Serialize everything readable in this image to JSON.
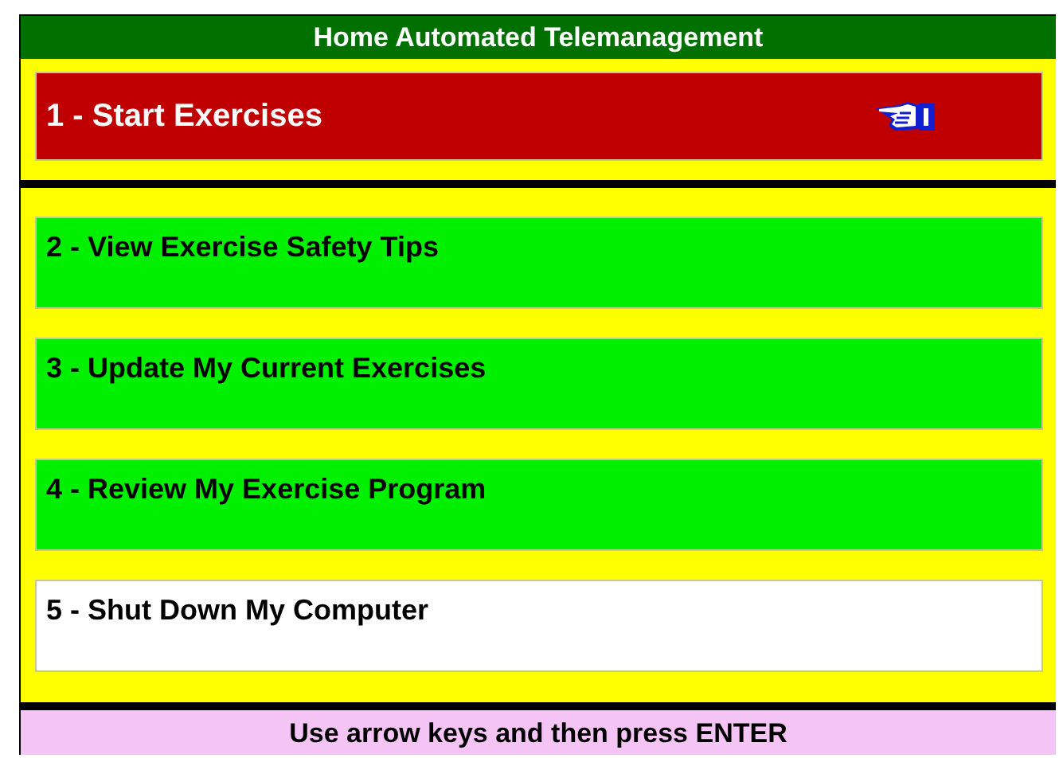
{
  "title": "Home Automated Telemanagement",
  "menu": [
    {
      "label": "1 - Start Exercises",
      "kind": "exercise",
      "selected": true
    },
    {
      "label": "2 - View Exercise Safety Tips",
      "kind": "exercise",
      "selected": false
    },
    {
      "label": "3 - Update My Current Exercises",
      "kind": "exercise",
      "selected": false
    },
    {
      "label": "4 - Review My Exercise Program",
      "kind": "exercise",
      "selected": false
    },
    {
      "label": "5 - Shut Down My Computer",
      "kind": "system",
      "selected": false
    }
  ],
  "footer": "Use arrow keys and then press ENTER"
}
